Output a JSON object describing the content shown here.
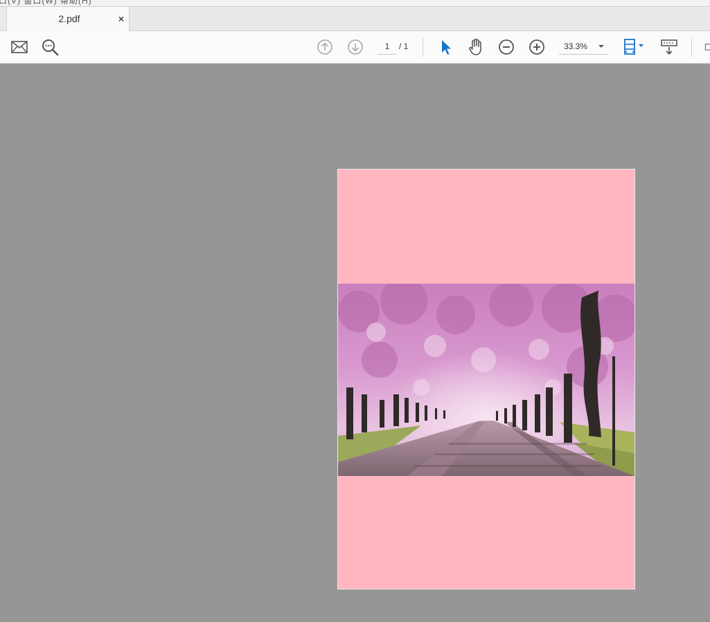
{
  "menu": {
    "partial_text": "口(V)   窗口(W)   帮助(H)"
  },
  "tab": {
    "title": "2.pdf",
    "close_glyph": "×"
  },
  "toolbar": {
    "icons": {
      "email": "envelope-icon",
      "search": "magnifier-icon",
      "prev_page": "arrow-up-circle-icon",
      "next_page": "arrow-down-circle-icon",
      "select": "pointer-arrow-icon",
      "hand": "hand-icon",
      "zoom_out": "minus-circle-icon",
      "zoom_in": "plus-circle-icon",
      "fit_page": "fit-page-icon",
      "scroll_mode": "scroll-mode-icon"
    },
    "page": {
      "current": "1",
      "total": "/ 1"
    },
    "zoom": {
      "value": "33.3%"
    }
  },
  "colors": {
    "workspace_bg": "#969696",
    "page_bg": "#ffb6c1",
    "accent_blue": "#1a73c9",
    "icon_gray": "#555555",
    "icon_disabled": "#b0b0b0"
  },
  "document": {
    "image_subject": "cherry-blossom-tree-lined-road"
  }
}
